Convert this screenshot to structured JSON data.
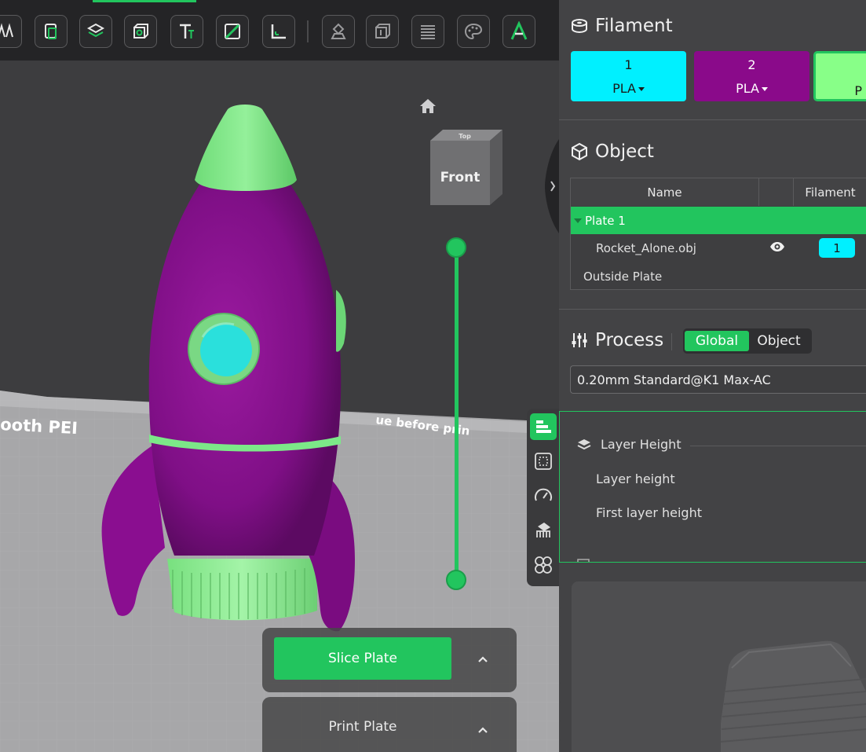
{
  "colors": {
    "accent": "#22c55e",
    "filament_1": "#00f0ff",
    "filament_2": "#8a0a8a",
    "filament_3": "#88ff88"
  },
  "viewport": {
    "bed_text": "ooth PEI",
    "bed_text_2": "ue before prin",
    "view_cube": {
      "face_front": "Front",
      "face_top": "Top"
    },
    "slice_button": "Slice Plate",
    "print_button": "Print Plate"
  },
  "filament": {
    "title": "Filament",
    "slots": [
      {
        "number": "1",
        "material": "PLA"
      },
      {
        "number": "2",
        "material": "PLA"
      },
      {
        "number": "",
        "material": "P"
      }
    ]
  },
  "object": {
    "title": "Object",
    "columns": [
      "Name",
      "",
      "Filament"
    ],
    "plate_label": "Plate 1",
    "item_name": "Rocket_Alone.obj",
    "item_filament": "1",
    "outside_label": "Outside Plate"
  },
  "process": {
    "title": "Process",
    "mode_global": "Global",
    "mode_object": "Object",
    "profile": "0.20mm Standard@K1 Max-AC",
    "group_layer_height": "Layer Height",
    "layer_height_label": "Layer height",
    "first_layer_height_label": "First layer height"
  }
}
